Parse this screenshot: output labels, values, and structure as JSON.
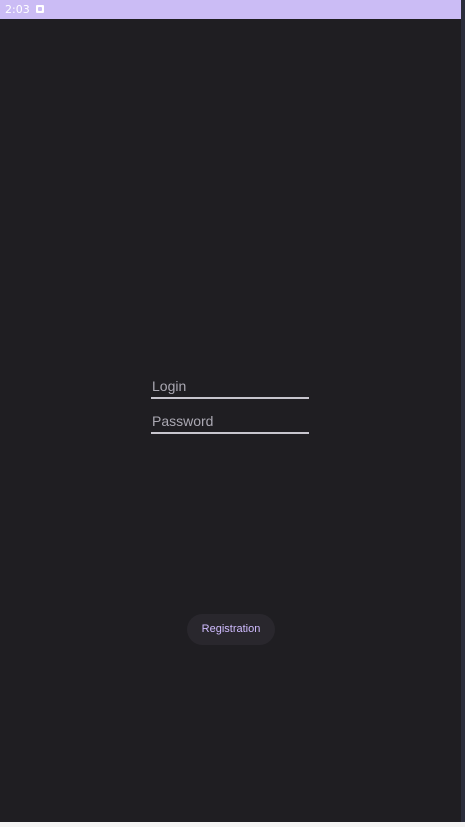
{
  "status_bar": {
    "time": "2:03",
    "notification_icon": "notification-square-icon"
  },
  "form": {
    "login_placeholder": "Login",
    "login_value": "",
    "password_placeholder": "Password",
    "password_value": ""
  },
  "actions": {
    "registration_label": "Registration"
  },
  "colors": {
    "status_bar": "#cbbcf5",
    "background": "#1f1e22",
    "accent": "#d0bcff",
    "button_bg": "#29272d",
    "field_underline": "#c7c5ce"
  }
}
